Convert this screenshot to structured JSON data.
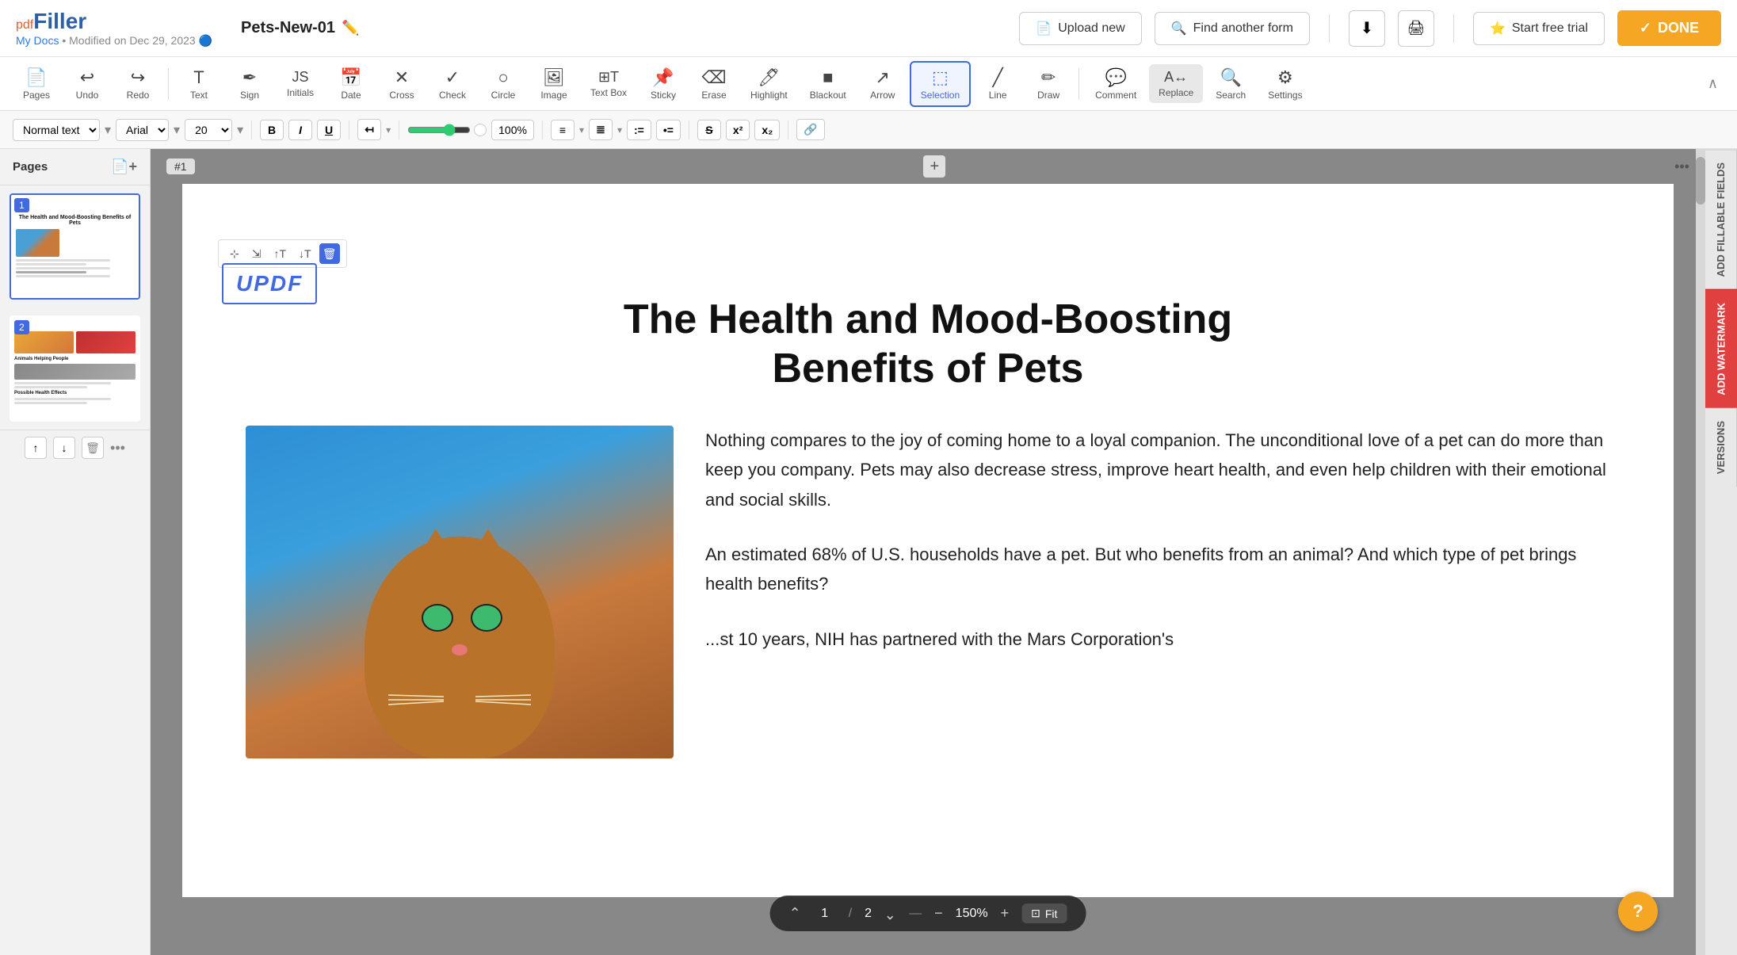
{
  "header": {
    "logo": "pdfFiller",
    "logo_pdf": "pdf",
    "logo_filler": "Filler",
    "doc_title": "Pets-New-01",
    "doc_subtitle": "My Docs",
    "modified_text": "Modified on Dec 29, 2023",
    "upload_btn": "Upload new",
    "find_btn": "Find another form",
    "start_trial_btn": "Start free trial",
    "done_btn": "DONE"
  },
  "toolbar": {
    "pages_label": "Pages",
    "undo_label": "Undo",
    "redo_label": "Redo",
    "text_label": "Text",
    "sign_label": "Sign",
    "initials_label": "Initials",
    "date_label": "Date",
    "cross_label": "Cross",
    "check_label": "Check",
    "circle_label": "Circle",
    "image_label": "Image",
    "textbox_label": "Text Box",
    "sticky_label": "Sticky",
    "erase_label": "Erase",
    "highlight_label": "Highlight",
    "blackout_label": "Blackout",
    "arrow_label": "Arrow",
    "selection_label": "Selection",
    "line_label": "Line",
    "draw_label": "Draw",
    "comment_label": "Comment",
    "replace_label": "Replace",
    "search_label": "Search",
    "settings_label": "Settings"
  },
  "format_toolbar": {
    "normal_text": "Normal text",
    "font": "Arial",
    "size": "20",
    "zoom": "100%"
  },
  "pages_panel": {
    "title": "Pages",
    "page1_num": "1",
    "page2_num": "2"
  },
  "pdf": {
    "page_label": "#1",
    "title_line1": "The Health and Mood-Boosting",
    "title_line2": "Benefits of Pets",
    "stamp_text": "UPDF",
    "paragraph1": "Nothing compares to the joy of coming home to a loyal companion. The unconditional love of a pet can do more than keep you company. Pets may also decrease stress, improve heart health,  and  even  help children  with  their emotional and social skills.",
    "paragraph2": "An estimated 68% of U.S. households have a pet. But who benefits from an animal? And which type of pet brings health benefits?",
    "paragraph3": "...st  10  years,  NIH  has partnered with the Mars Corporation's"
  },
  "bottom_nav": {
    "page_current": "1",
    "page_total": "2",
    "zoom": "150%",
    "fit_label": "Fit"
  },
  "right_panel": {
    "fillable_label": "ADD FILLABLE FIELDS",
    "watermark_label": "ADD WATERMARK",
    "versions_label": "VERSIONS"
  }
}
